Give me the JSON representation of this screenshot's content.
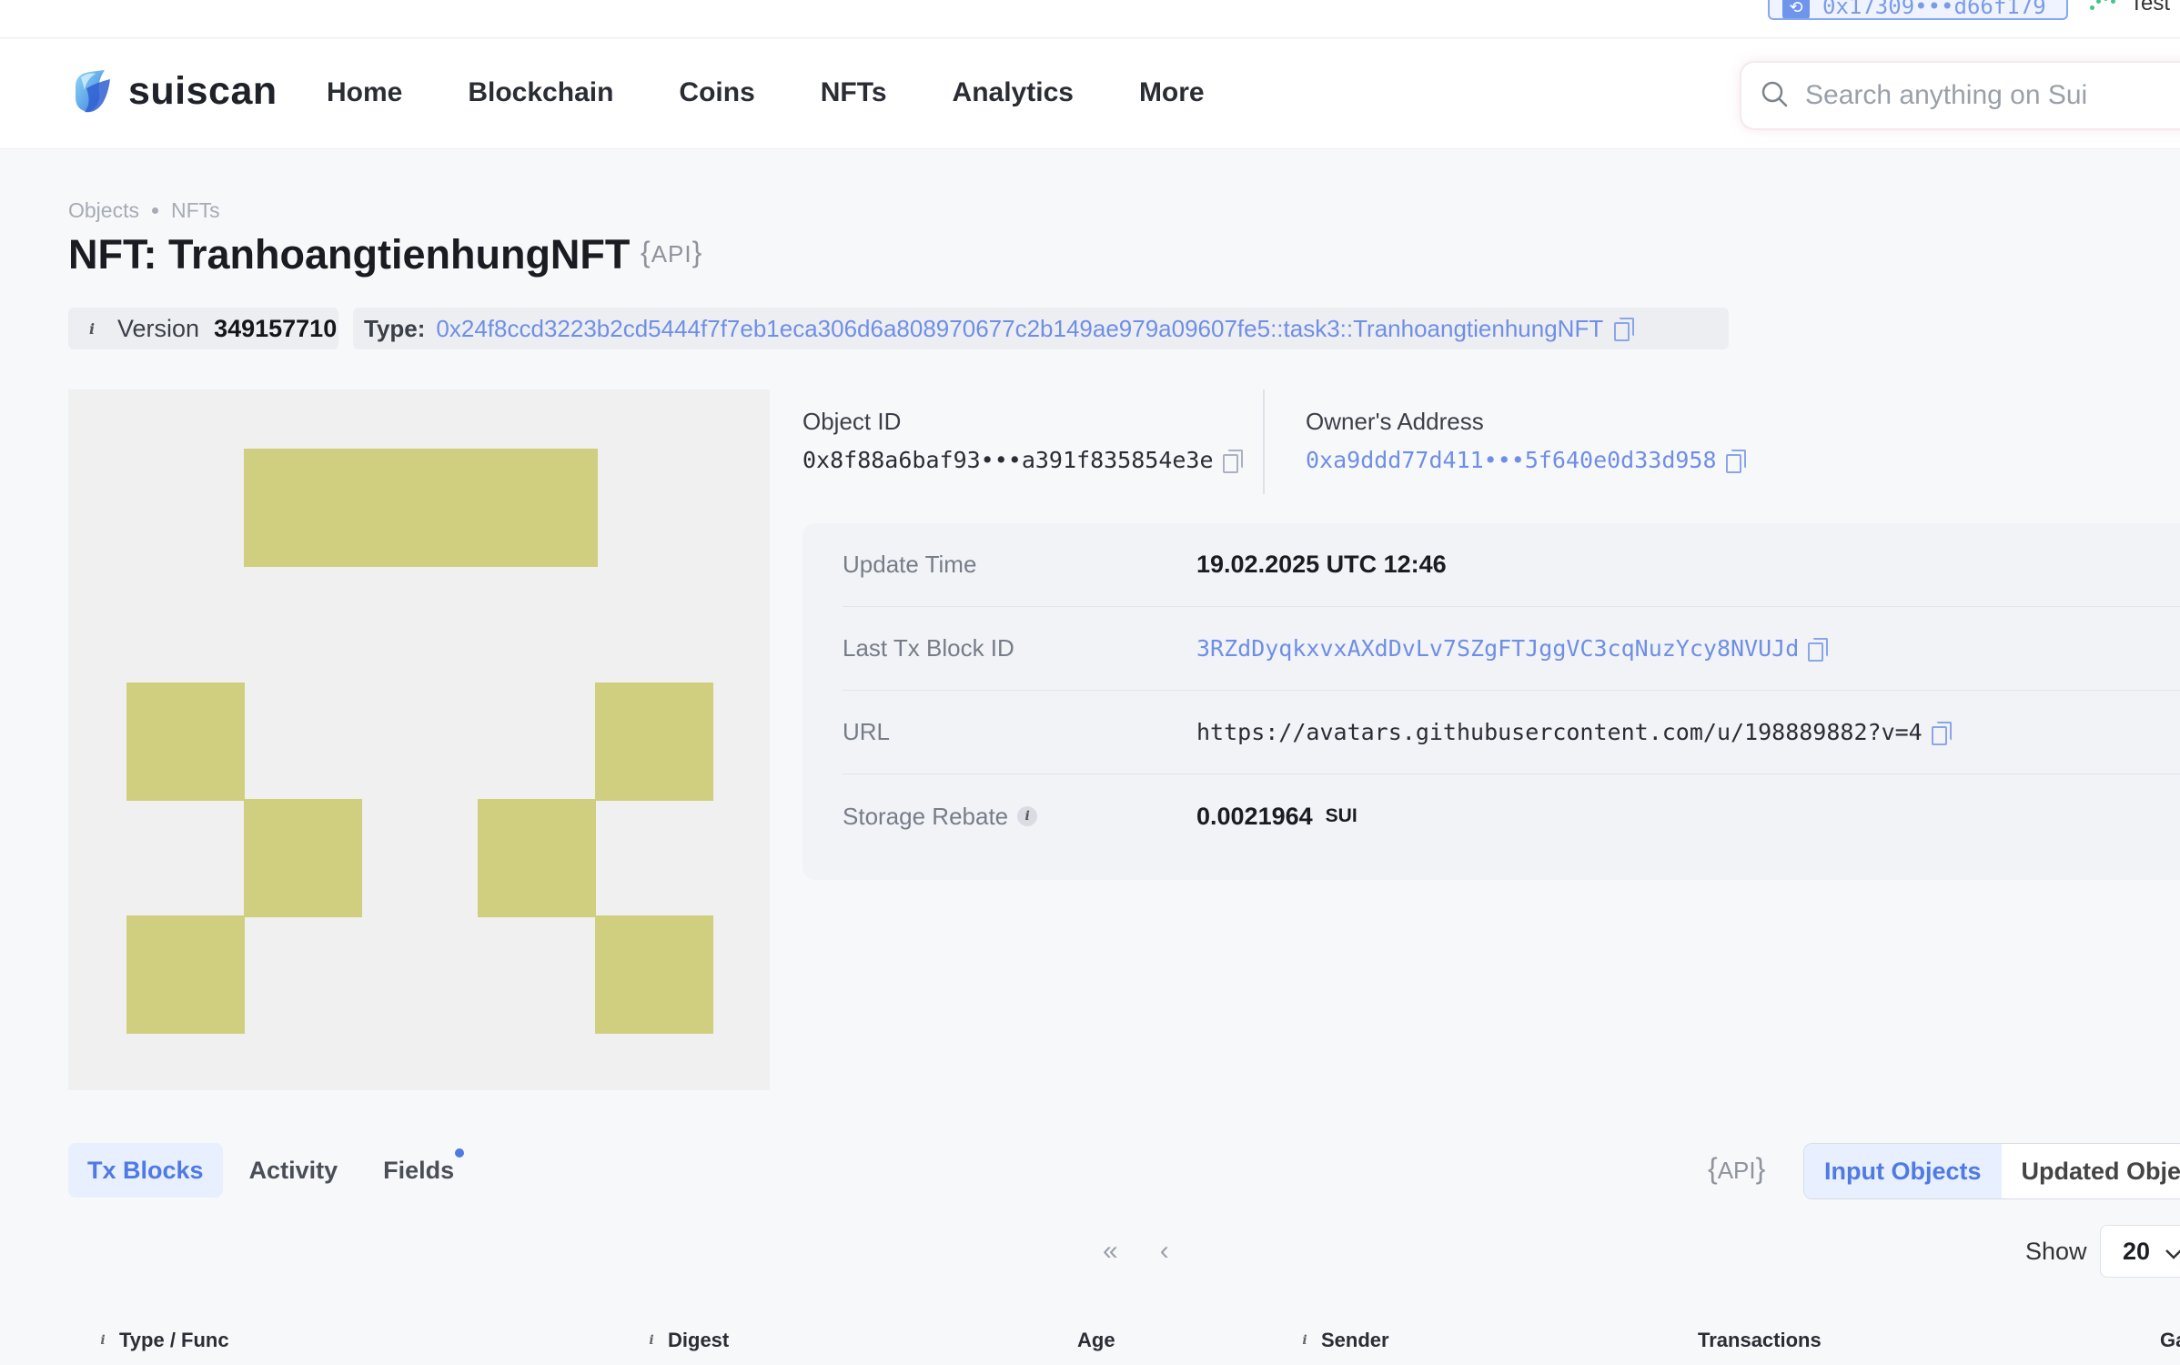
{
  "topbar": {
    "wallet_address": "0x17309•••d66f179",
    "network_label": "Test"
  },
  "header": {
    "logo_text": "suiscan",
    "nav": [
      "Home",
      "Blockchain",
      "Coins",
      "NFTs",
      "Analytics",
      "More"
    ],
    "search_placeholder": "Search anything on Sui"
  },
  "breadcrumb": [
    "Objects",
    "NFTs"
  ],
  "page": {
    "title": "NFT: TranhoangtienhungNFT",
    "api_label": "API",
    "version_label": "Version",
    "version_value": "349157710",
    "type_label": "Type:",
    "type_value": "0x24f8ccd3223b2cd5444f7f7eb1eca306d6a808970677c2b149ae979a09607fe5::task3::TranhoangtienhungNFT"
  },
  "object": {
    "id_label": "Object ID",
    "id_value": "0x8f88a6baf93•••a391f835854e3e",
    "owner_label": "Owner's Address",
    "owner_value": "0xa9ddd77d411•••5f640e0d33d958"
  },
  "nft_image": {
    "background": "#f0f0f0",
    "pixel_color": "#d0ce7f"
  },
  "details": [
    {
      "label": "Update Time",
      "value": "19.02.2025 UTC 12:46"
    },
    {
      "label": "Last Tx Block ID",
      "value": "3RZdDyqkxvxAXdDvLv7SZgFTJggVC3cqNuzYcy8NVUJd"
    },
    {
      "label": "URL",
      "value": "https://avatars.githubusercontent.com/u/198889882?v=4"
    },
    {
      "label": "Storage Rebate",
      "value": "0.0021964",
      "unit": "SUI"
    }
  ],
  "tabs": [
    "Tx Blocks",
    "Activity",
    "Fields"
  ],
  "tab_api_label": "API",
  "segment": [
    "Input Objects",
    "Updated Objects"
  ],
  "pager": {
    "first": "«",
    "prev": "‹"
  },
  "show": {
    "label": "Show",
    "value": "20"
  },
  "table_headers": [
    "Type / Func",
    "Digest",
    "Age",
    "Sender",
    "Transactions",
    "Gas"
  ],
  "colors": {
    "accent": "#4f7ae3",
    "link": "#6f8fe6",
    "nft_pixel": "#d0ce7f"
  }
}
